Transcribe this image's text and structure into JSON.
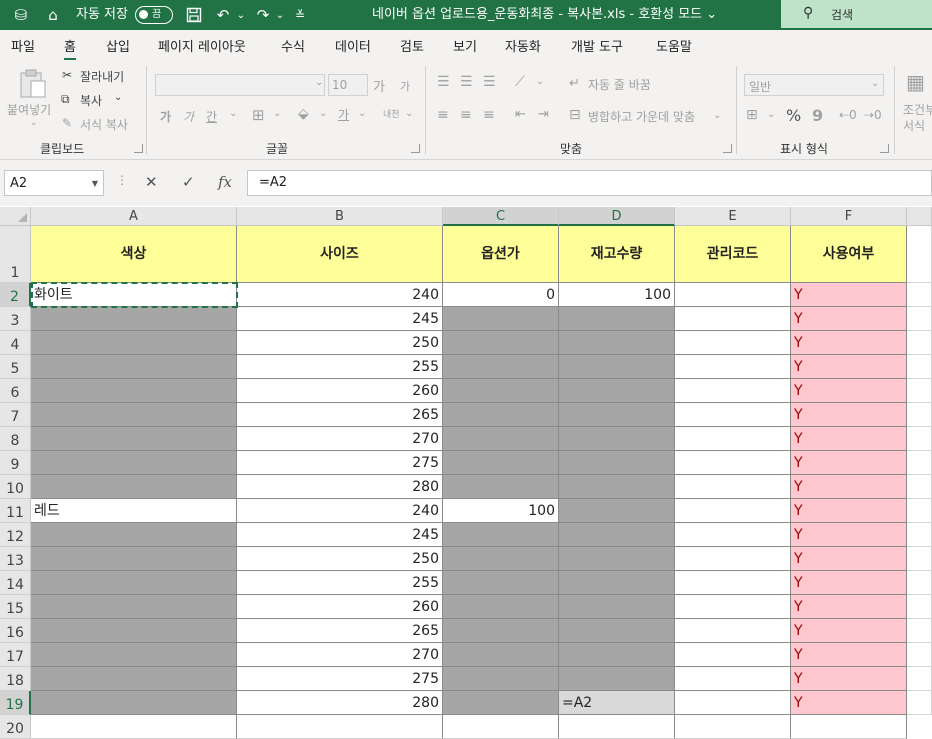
{
  "titlebar": {
    "autosave_label": "자동 저장",
    "autosave_state": "끔",
    "title": "네이버 옵션 업로드용_운동화최종 - 복사본.xls  -  호환성 모드",
    "title_chevron": "⌄",
    "search_label": "검색",
    "brand_color": "#217346"
  },
  "menu": {
    "tabs": [
      "파일",
      "홈",
      "삽입",
      "페이지 레이아웃",
      "수식",
      "데이터",
      "검토",
      "보기",
      "자동화",
      "개발 도구",
      "도움말"
    ],
    "active_tab": "홈"
  },
  "ribbon": {
    "clipboard": {
      "paste": "붙여넣기",
      "cut": "잘라내기",
      "copy": "복사",
      "format_painter": "서식 복사",
      "label": "클립보드"
    },
    "font": {
      "font_size": "10",
      "grow": "가",
      "shrink": "가",
      "bold": "가",
      "italic": "가",
      "underline": "간",
      "phonetic": "내천",
      "label": "글꼴"
    },
    "alignment": {
      "wrap": "자동 줄 바꿈",
      "merge": "병합하고 가운데 맞춤",
      "label": "맞춤"
    },
    "number": {
      "format": "일반",
      "percent": "%",
      "comma": "9",
      "label": "표시 형식"
    },
    "styles": {
      "conditional_line1": "조건부",
      "conditional_line2": "서식"
    }
  },
  "formula_bar": {
    "name_box": "A2",
    "formula": "=A2",
    "cancel": "✕",
    "enter": "✓",
    "fx": "fx"
  },
  "grid": {
    "columns": [
      "A",
      "B",
      "C",
      "D",
      "E",
      "F"
    ],
    "header_row": [
      "색상",
      "사이즈",
      "옵션가",
      "재고수량",
      "관리코드",
      "사용여부"
    ],
    "rows": [
      {
        "n": "2",
        "A": "화이트",
        "B": "240",
        "C": "0",
        "D": "100",
        "F": "Y"
      },
      {
        "n": "3",
        "A": "",
        "B": "245",
        "C": "",
        "D": "",
        "F": "Y"
      },
      {
        "n": "4",
        "A": "",
        "B": "250",
        "C": "",
        "D": "",
        "F": "Y"
      },
      {
        "n": "5",
        "A": "",
        "B": "255",
        "C": "",
        "D": "",
        "F": "Y"
      },
      {
        "n": "6",
        "A": "",
        "B": "260",
        "C": "",
        "D": "",
        "F": "Y"
      },
      {
        "n": "7",
        "A": "",
        "B": "265",
        "C": "",
        "D": "",
        "F": "Y"
      },
      {
        "n": "8",
        "A": "",
        "B": "270",
        "C": "",
        "D": "",
        "F": "Y"
      },
      {
        "n": "9",
        "A": "",
        "B": "275",
        "C": "",
        "D": "",
        "F": "Y"
      },
      {
        "n": "10",
        "A": "",
        "B": "280",
        "C": "",
        "D": "",
        "F": "Y"
      },
      {
        "n": "11",
        "A": "레드",
        "B": "240",
        "C": "100",
        "D": "",
        "F": "Y"
      },
      {
        "n": "12",
        "A": "",
        "B": "245",
        "C": "",
        "D": "",
        "F": "Y"
      },
      {
        "n": "13",
        "A": "",
        "B": "250",
        "C": "",
        "D": "",
        "F": "Y"
      },
      {
        "n": "14",
        "A": "",
        "B": "255",
        "C": "",
        "D": "",
        "F": "Y"
      },
      {
        "n": "15",
        "A": "",
        "B": "260",
        "C": "",
        "D": "",
        "F": "Y"
      },
      {
        "n": "16",
        "A": "",
        "B": "265",
        "C": "",
        "D": "",
        "F": "Y"
      },
      {
        "n": "17",
        "A": "",
        "B": "270",
        "C": "",
        "D": "",
        "F": "Y"
      },
      {
        "n": "18",
        "A": "",
        "B": "275",
        "C": "",
        "D": "",
        "F": "Y"
      },
      {
        "n": "19",
        "A": "",
        "B": "280",
        "C": "",
        "D": "=A2",
        "F": "Y"
      }
    ],
    "last_row_number": "20",
    "header_row_number": "1",
    "colors": {
      "header_fill": "#ffff99",
      "empty_fill": "#a6a6a6",
      "editing_fill": "#d9d9d9",
      "flag_fill": "#ffc7ce",
      "flag_text": "#9c0006"
    }
  }
}
